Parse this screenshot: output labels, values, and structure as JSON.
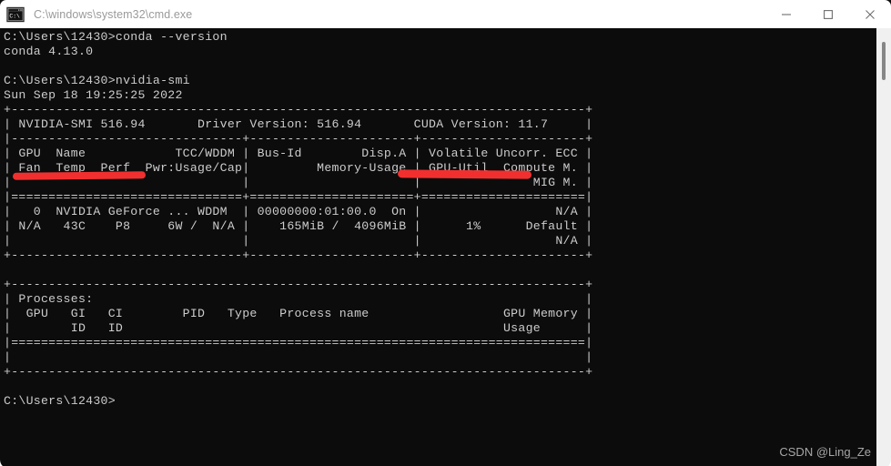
{
  "window": {
    "title": "C:\\windows\\system32\\cmd.exe",
    "icon": "cmd-console-icon",
    "controls": [
      {
        "name": "minimize-button",
        "glyph": "minimize-icon",
        "label": "Minimize"
      },
      {
        "name": "maximize-button",
        "glyph": "maximize-icon",
        "label": "Maximize"
      },
      {
        "name": "close-button",
        "glyph": "close-icon",
        "label": "Close"
      }
    ]
  },
  "terminal": {
    "background": "#0c0c0c",
    "foreground": "#cccccc",
    "lines": [
      "C:\\Users\\12430>conda --version",
      "conda 4.13.0",
      "",
      "C:\\Users\\12430>nvidia-smi",
      "Sun Sep 18 19:25:25 2022",
      "+-----------------------------------------------------------------------------+",
      "| NVIDIA-SMI 516.94       Driver Version: 516.94       CUDA Version: 11.7     |",
      "|-------------------------------+----------------------+----------------------+",
      "| GPU  Name            TCC/WDDM | Bus-Id        Disp.A | Volatile Uncorr. ECC |",
      "| Fan  Temp  Perf  Pwr:Usage/Cap|         Memory-Usage | GPU-Util  Compute M. |",
      "|                               |                      |               MIG M. |",
      "|===============================+======================+======================|",
      "|   0  NVIDIA GeForce ... WDDM  | 00000000:01:00.0  On |                  N/A |",
      "| N/A   43C    P8     6W /  N/A |    165MiB /  4096MiB |      1%      Default |",
      "|                               |                      |                  N/A |",
      "+-------------------------------+----------------------+----------------------+",
      "",
      "+-----------------------------------------------------------------------------+",
      "| Processes:                                                                  |",
      "|  GPU   GI   CI        PID   Type   Process name                  GPU Memory |",
      "|        ID   ID                                                   Usage      |",
      "|=============================================================================|",
      "|                                                                             |",
      "+-----------------------------------------------------------------------------+",
      "",
      "C:\\Users\\12430>"
    ],
    "commands": [
      {
        "prompt": "C:\\Users\\12430>",
        "command": "conda --version",
        "output": "conda 4.13.0"
      },
      {
        "prompt": "C:\\Users\\12430>",
        "command": "nvidia-smi",
        "output": "Sun Sep 18 19:25:25 2022"
      }
    ],
    "nvidia_smi": {
      "timestamp": "Sun Sep 18 19:25:25 2022",
      "smi_version": "NVIDIA-SMI 516.94",
      "driver_version": "Driver Version: 516.94",
      "cuda_version": "CUDA Version: 11.7",
      "column_headers": [
        "GPU  Name            TCC/WDDM",
        "Fan  Temp  Perf  Pwr:Usage/Cap",
        "Bus-Id        Disp.A",
        "Memory-Usage",
        "Volatile Uncorr. ECC",
        "GPU-Util  Compute M.",
        "MIG M."
      ],
      "gpus": [
        {
          "index": "0",
          "name": "NVIDIA GeForce ...",
          "driver_model": "WDDM",
          "bus_id": "00000000:01:00.0",
          "display_active": "On",
          "ecc": "N/A",
          "fan": "N/A",
          "temp": "43C",
          "perf": "P8",
          "power": "6W /  N/A",
          "memory": "165MiB /  4096MiB",
          "gpu_util": "1%",
          "compute_mode": "Default",
          "mig_mode": "N/A"
        }
      ],
      "processes": {
        "title": "Processes:",
        "headers": [
          "GPU",
          "GI",
          "CI",
          "PID",
          "Type",
          "Process name",
          "GPU Memory"
        ],
        "subheaders": [
          "ID",
          "ID",
          "Usage"
        ],
        "rows": []
      }
    },
    "final_prompt": "C:\\Users\\12430>"
  },
  "annotations": {
    "color": "#f22f2f",
    "marks": [
      {
        "name": "nvidia-smi-underline",
        "target": "NVIDIA-SMI 516.94"
      },
      {
        "name": "cuda-version-underline",
        "target": "CUDA Version: 11.7"
      }
    ]
  },
  "scrollbar": {
    "name": "vertical-scrollbar",
    "thumb_position": "top"
  },
  "watermark": {
    "text": "CSDN @Ling_Ze"
  }
}
